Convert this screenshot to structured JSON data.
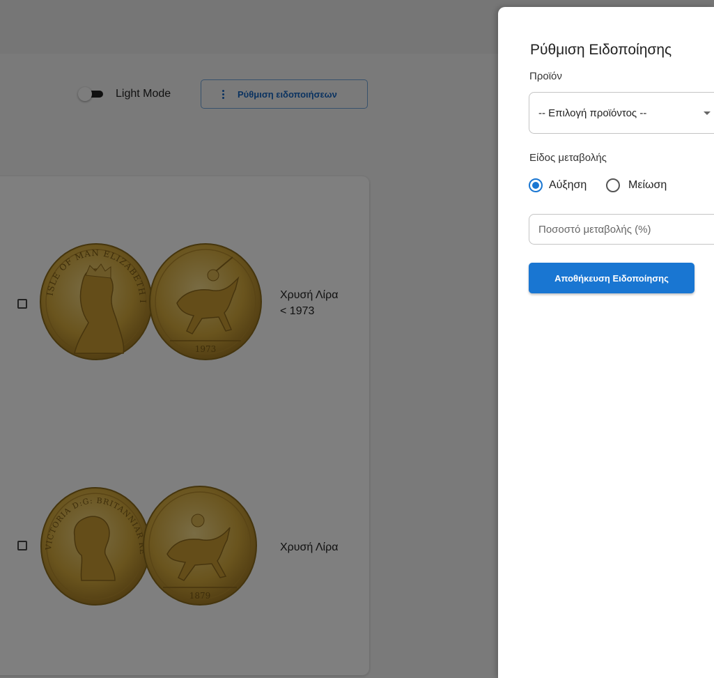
{
  "toolbar": {
    "theme_toggle_label": "Light Mode",
    "notifications_button_label": "Ρύθμιση ειδοποιήσεων"
  },
  "products": [
    {
      "label_line1": "Χρυσή Λίρα",
      "label_line2": "< 1973",
      "front_inscription": "ISLE OF MAN ELIZABETH II",
      "back_year": "1973"
    },
    {
      "label_line1": "Χρυσή Λίρα",
      "label_line2": "",
      "front_inscription": "VICTORIA D:G: BRITANNIAR REG: F:D:",
      "back_year": "1879"
    }
  ],
  "drawer": {
    "title": "Ρύθμιση Ειδοποίησης",
    "product_label": "Προϊόν",
    "product_select_value": "-- Επιλογή προϊόντος --",
    "change_type_label": "Είδος μεταβολής",
    "change_options": [
      {
        "label": "Αύξηση",
        "checked": true
      },
      {
        "label": "Μείωση",
        "checked": false
      }
    ],
    "percent_placeholder": "Ποσοστό μεταβολής (%)",
    "save_button_label": "Αποθήκευση Ειδοποίησης"
  },
  "colors": {
    "accent": "#1976d2",
    "backdrop": "rgba(0,0,0,0.5)",
    "gold": "#c9a227"
  }
}
